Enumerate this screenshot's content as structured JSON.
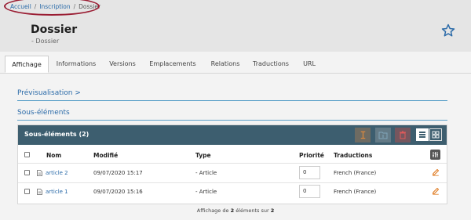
{
  "breadcrumb": {
    "items": [
      "Accueil",
      "Inscription",
      "Dossier"
    ],
    "separator": "/"
  },
  "page": {
    "title": "Dossier",
    "subtitle": "- Dossier"
  },
  "tabs": [
    "Affichage",
    "Informations",
    "Versions",
    "Emplacements",
    "Relations",
    "Traductions",
    "URL"
  ],
  "active_tab": "Affichage",
  "sections": {
    "preview": "Prévisualisation",
    "preview_chevron": ">",
    "subelements": "Sous-éléments"
  },
  "panel": {
    "title": "Sous-éléments (2)",
    "columns": [
      "Nom",
      "Modifié",
      "Type",
      "Priorité",
      "Traductions"
    ],
    "rows": [
      {
        "name": "article 2",
        "modified": "09/07/2020 15:17",
        "type": "- Article",
        "priority": "0",
        "translations": "French (France)"
      },
      {
        "name": "article 1",
        "modified": "09/07/2020 15:16",
        "type": "- Article",
        "priority": "0",
        "translations": "French (France)"
      }
    ]
  },
  "footer": {
    "prefix": "Affichage de",
    "shown": "2",
    "middle": "éléments sur",
    "total": "2"
  },
  "colors": {
    "accent": "#2a6aa8",
    "panel_header": "#3d5e6f",
    "edit": "#e07b22",
    "highlight": "#9a1d33"
  },
  "icons": {
    "star": "star-icon",
    "doc": "document-icon",
    "edit": "pencil-icon",
    "columns": "sliders-icon"
  }
}
